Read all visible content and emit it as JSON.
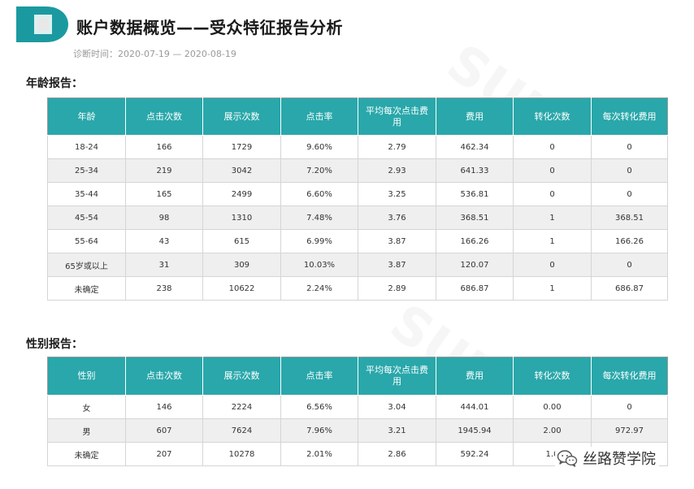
{
  "header": {
    "title": "账户数据概览——受众特征报告分析",
    "diagnosis_time": "诊断时间：2020-07-19 — 2020-08-19"
  },
  "colors": {
    "header_teal": "#29a7aa",
    "logo_teal": "#1a9aa0",
    "row_alt": "#efefef"
  },
  "watermark": {
    "primary": "SUIIV",
    "secondary": "SUIIV"
  },
  "age_report": {
    "title": "年龄报告：",
    "columns": [
      "年龄",
      "点击次数",
      "展示次数",
      "点击率",
      "平均每次点击费用",
      "费用",
      "转化次数",
      "每次转化费用"
    ],
    "rows": [
      [
        "18-24",
        "166",
        "1729",
        "9.60%",
        "2.79",
        "462.34",
        "0",
        "0"
      ],
      [
        "25-34",
        "219",
        "3042",
        "7.20%",
        "2.93",
        "641.33",
        "0",
        "0"
      ],
      [
        "35-44",
        "165",
        "2499",
        "6.60%",
        "3.25",
        "536.81",
        "0",
        "0"
      ],
      [
        "45-54",
        "98",
        "1310",
        "7.48%",
        "3.76",
        "368.51",
        "1",
        "368.51"
      ],
      [
        "55-64",
        "43",
        "615",
        "6.99%",
        "3.87",
        "166.26",
        "1",
        "166.26"
      ],
      [
        "65岁或以上",
        "31",
        "309",
        "10.03%",
        "3.87",
        "120.07",
        "0",
        "0"
      ],
      [
        "未确定",
        "238",
        "10622",
        "2.24%",
        "2.89",
        "686.87",
        "1",
        "686.87"
      ]
    ]
  },
  "gender_report": {
    "title": "性别报告：",
    "columns": [
      "性别",
      "点击次数",
      "展示次数",
      "点击率",
      "平均每次点击费用",
      "费用",
      "转化次数",
      "每次转化费用"
    ],
    "rows": [
      [
        "女",
        "146",
        "2224",
        "6.56%",
        "3.04",
        "444.01",
        "0.00",
        "0"
      ],
      [
        "男",
        "607",
        "7624",
        "7.96%",
        "3.21",
        "1945.94",
        "2.00",
        "972.97"
      ],
      [
        "未确定",
        "207",
        "10278",
        "2.01%",
        "2.86",
        "592.24",
        "1.0",
        ""
      ]
    ]
  },
  "wechat": {
    "icon": "wechat-icon",
    "account_name": "丝路赞学院"
  }
}
